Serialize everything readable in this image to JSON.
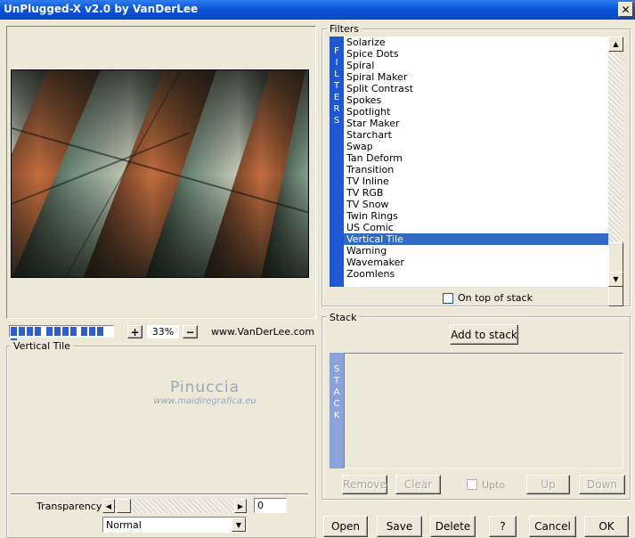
{
  "window": {
    "title": "UnPlugged-X v2.0 by VanDerLee",
    "close_glyph": "✕"
  },
  "preview": {
    "zoom_out_label": "−",
    "zoom_in_label": "+",
    "zoom_value": "33%",
    "website": "www.VanDerLee.com",
    "progress_percent": 100
  },
  "filters": {
    "group_label": "Filters",
    "strip_letters": [
      "F",
      "I",
      "L",
      "T",
      "E",
      "R",
      "S"
    ],
    "items": [
      "Solarize",
      "Spice Dots",
      "Spiral",
      "Spiral Maker",
      "Split Contrast",
      "Spokes",
      "Spotlight",
      "Star Maker",
      "Starchart",
      "Swap",
      "Tan Deform",
      "Transition",
      "TV Inline",
      "TV RGB",
      "TV Snow",
      "Twin Rings",
      "US Comic",
      "Vertical Tile",
      "Warning",
      "Wavemaker",
      "Zoomlens"
    ],
    "selected": "Vertical Tile",
    "on_top_label": "On top of stack"
  },
  "stack": {
    "group_label": "Stack",
    "strip_letters": [
      "S",
      "T",
      "A",
      "C",
      "K"
    ],
    "add_label": "Add to stack",
    "remove_label": "Remove",
    "clear_label": "Clear",
    "upto_label": "Upto",
    "up_label": "Up",
    "down_label": "Down"
  },
  "settings": {
    "group_label": "Vertical Tile",
    "watermark_title": "Pinuccia",
    "watermark_url": "www.maidiregrafica.eu",
    "transparency_label": "Transparency",
    "transparency_value": "0",
    "blend_mode": "Normal"
  },
  "footer": {
    "open": "Open",
    "save": "Save",
    "delete": "Delete",
    "help": "?",
    "cancel": "Cancel",
    "ok": "OK"
  },
  "colors": {
    "titlebar": "#0a54d8",
    "selection": "#316ac5",
    "filters_strip": "#1e57d6",
    "stack_strip": "#8aa3dc",
    "progress": "#2d5bd2"
  }
}
